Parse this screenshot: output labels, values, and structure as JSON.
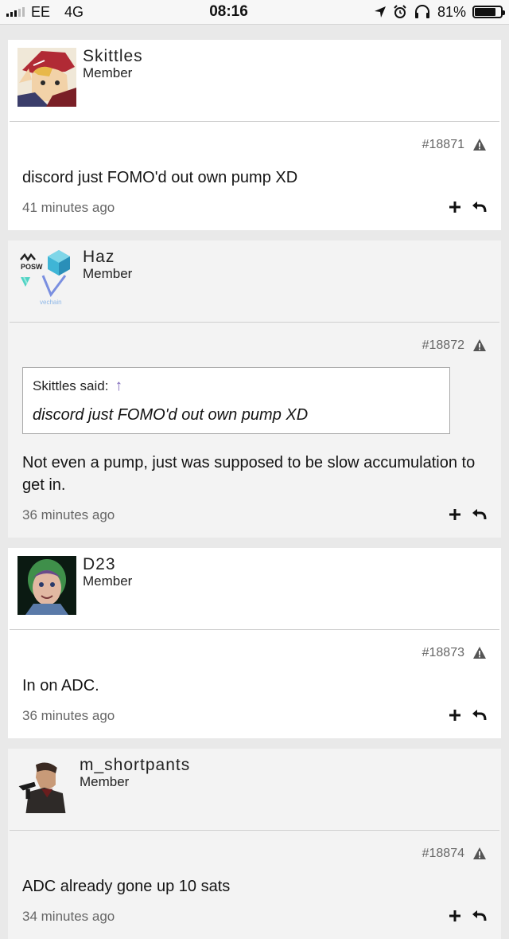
{
  "status_bar": {
    "carrier": "EE",
    "network": "4G",
    "time": "08:16",
    "battery": "81%",
    "battery_level": 0.81,
    "icons": [
      "signal-icon",
      "location-arrow-icon",
      "alarm-icon",
      "headphones-icon",
      "battery-icon"
    ]
  },
  "posts": [
    {
      "author": "Skittles",
      "role": "Member",
      "post_number": "#18871",
      "message": "discord just FOMO'd out own pump XD",
      "time": "41 minutes ago",
      "avatar_icon": "anime-character-avatar"
    },
    {
      "author": "Haz",
      "role": "Member",
      "post_number": "#18872",
      "quote": {
        "author_label": "Skittles said:",
        "text": "discord just FOMO'd out own pump XD"
      },
      "message": "Not even a pump, just was supposed to be slow accumulation to get in.",
      "time": "36 minutes ago",
      "avatar_icon": "posw-vechain-logo-avatar",
      "avatar_text": {
        "posw": "POSW",
        "vechain": "vechain"
      }
    },
    {
      "author": "D23",
      "role": "Member",
      "post_number": "#18873",
      "message": "In on ADC.",
      "time": "36 minutes ago",
      "avatar_icon": "buzz-lightyear-avatar"
    },
    {
      "author": "m_shortpants",
      "role": "Member",
      "post_number": "#18874",
      "message": "ADC already gone up 10 sats",
      "time": "34 minutes ago",
      "avatar_icon": "gunman-avatar"
    }
  ],
  "colors": {
    "background": "#e9e9e9",
    "post_light": "#ffffff",
    "post_grey": "#f3f3f3",
    "quote_arrow": "#7a64b8",
    "muted_text": "#666666"
  }
}
